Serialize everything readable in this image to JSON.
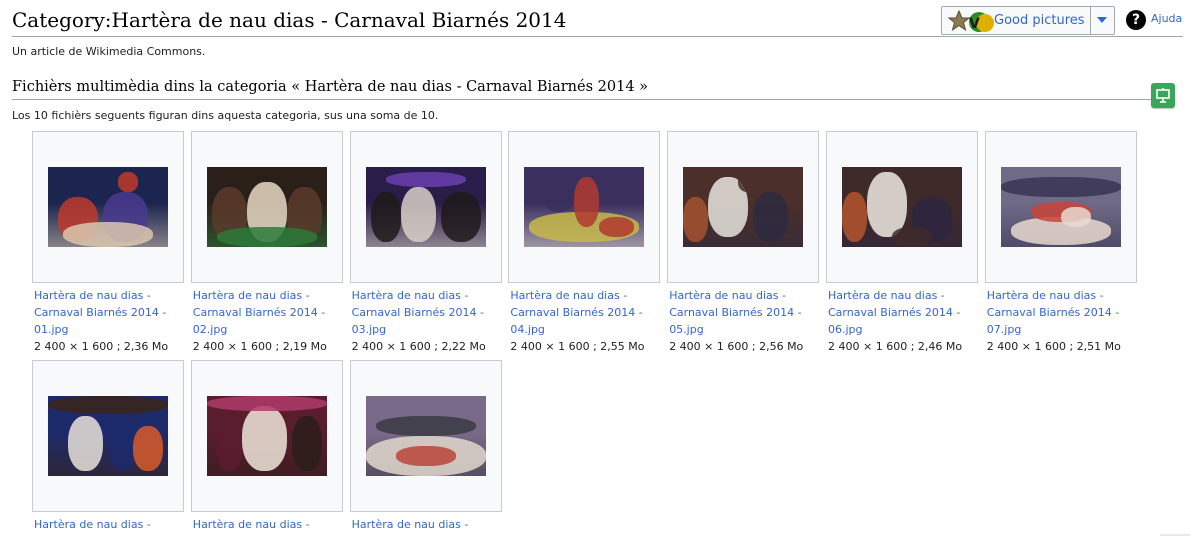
{
  "page": {
    "title": "Category:Hartèra de nau dias - Carnaval Biarnés 2014",
    "tagline": "Un article de Wikimedia Commons."
  },
  "toolbar": {
    "good_pictures_label": "Good pictures",
    "help_label": "Ajuda",
    "help_icon_glyph": "?"
  },
  "section": {
    "title": "Fichièrs multimèdia dins la categoria « Hartèra de nau dias - Carnaval Biarnés 2014 »",
    "count_text": "Los 10 fichièrs seguents figuran dins aquesta categoria, sus una soma de 10."
  },
  "gallery": [
    {
      "name_line1": "Hartèra de nau dias -",
      "name_line2": "Carnaval Biarnés 2014 -",
      "name_line3": "01.jpg",
      "meta": "2 400 × 1 600 ; 2,36 Mo",
      "palette": [
        "#1b2550",
        "#4a3a8f",
        "#c0392b",
        "#d9c7b0"
      ]
    },
    {
      "name_line1": "Hartèra de nau dias -",
      "name_line2": "Carnaval Biarnés 2014 -",
      "name_line3": "02.jpg",
      "meta": "2 400 × 1 600 ; 2,19 Mo",
      "palette": [
        "#2b1f1a",
        "#5a3b2c",
        "#e8d9c4",
        "#2c7a3a"
      ]
    },
    {
      "name_line1": "Hartèra de nau dias -",
      "name_line2": "Carnaval Biarnés 2014 -",
      "name_line3": "03.jpg",
      "meta": "2 400 × 1 600 ; 2,22 Mo",
      "palette": [
        "#2a1d4a",
        "#6b3fb0",
        "#1e1a1a",
        "#d8cfc5"
      ]
    },
    {
      "name_line1": "Hartèra de nau dias -",
      "name_line2": "Carnaval Biarnés 2014 -",
      "name_line3": "04.jpg",
      "meta": "2 400 × 1 600 ; 2,55 Mo",
      "palette": [
        "#3b2f5e",
        "#c7b84a",
        "#b23a2f",
        "#e6e0d6"
      ]
    },
    {
      "name_line1": "Hartèra de nau dias -",
      "name_line2": "Carnaval Biarnés 2014 -",
      "name_line3": "05.jpg",
      "meta": "2 400 × 1 600 ; 2,56 Mo",
      "palette": [
        "#4a2f2a",
        "#e8e4df",
        "#a5512f",
        "#2d2a40"
      ]
    },
    {
      "name_line1": "Hartèra de nau dias -",
      "name_line2": "Carnaval Biarnés 2014 -",
      "name_line3": "06.jpg",
      "meta": "2 400 × 1 600 ; 2,46 Mo",
      "palette": [
        "#3f2a2a",
        "#efe9e2",
        "#b5532e",
        "#2d2540"
      ]
    },
    {
      "name_line1": "Hartèra de nau dias -",
      "name_line2": "Carnaval Biarnés 2014 -",
      "name_line3": "07.jpg",
      "meta": "2 400 × 1 600 ; 2,51 Mo",
      "palette": [
        "#6f6a86",
        "#c9453a",
        "#e7d9cf",
        "#3a3355"
      ]
    },
    {
      "name_line1": "Hartèra de nau dias -",
      "name_line2": "",
      "name_line3": "",
      "meta": "",
      "palette": [
        "#1d2a6b",
        "#d95a2a",
        "#e9e2da",
        "#3a2418"
      ]
    },
    {
      "name_line1": "Hartèra de nau dias -",
      "name_line2": "",
      "name_line3": "",
      "meta": "",
      "palette": [
        "#5a1d2e",
        "#b03a6a",
        "#efe6da",
        "#2a1d1a"
      ]
    },
    {
      "name_line1": "Hartèra de nau dias -",
      "name_line2": "",
      "name_line3": "",
      "meta": "",
      "palette": [
        "#7a6a8a",
        "#b8443a",
        "#e2d8cc",
        "#3b3a44"
      ]
    }
  ]
}
